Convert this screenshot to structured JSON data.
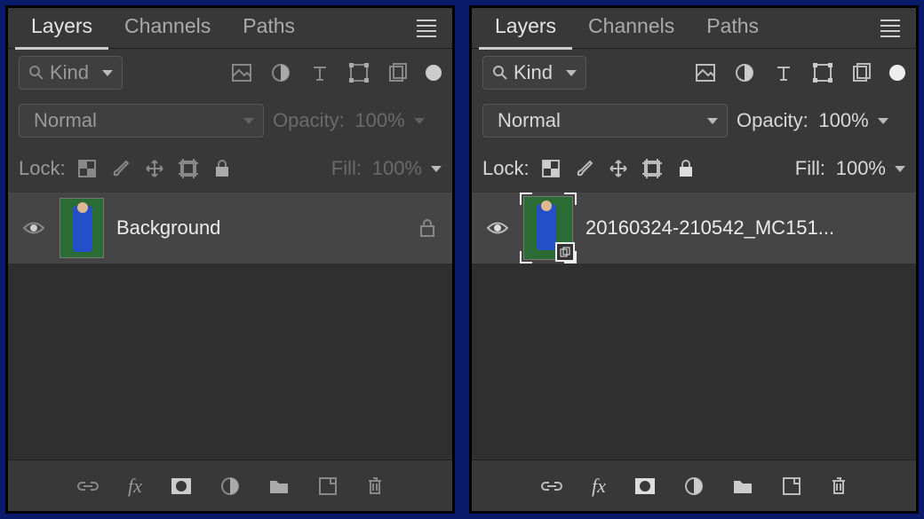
{
  "panels": [
    {
      "tabs": [
        "Layers",
        "Channels",
        "Paths"
      ],
      "active_tab": "Layers",
      "kind_label": "Kind",
      "blend_mode": "Normal",
      "opacity_label": "Opacity:",
      "opacity_value": "100%",
      "fill_label": "Fill:",
      "fill_value": "100%",
      "lock_label": "Lock:",
      "layer_name": "Background",
      "locked": true,
      "smart_object": false,
      "controls_enabled": false
    },
    {
      "tabs": [
        "Layers",
        "Channels",
        "Paths"
      ],
      "active_tab": "Layers",
      "kind_label": "Kind",
      "blend_mode": "Normal",
      "opacity_label": "Opacity:",
      "opacity_value": "100%",
      "fill_label": "Fill:",
      "fill_value": "100%",
      "lock_label": "Lock:",
      "layer_name": "20160324-210542_MC151...",
      "locked": false,
      "smart_object": true,
      "controls_enabled": true
    }
  ]
}
